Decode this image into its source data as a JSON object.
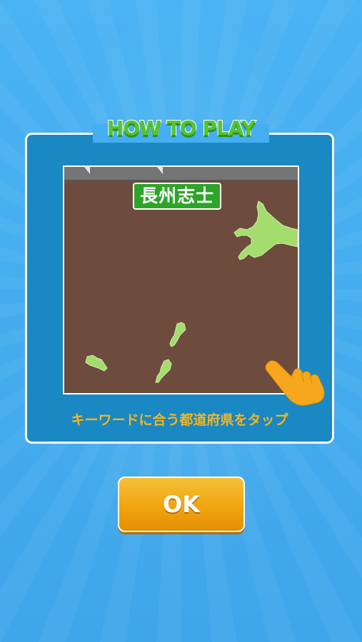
{
  "screen": {
    "title": "HOW TO PLAY",
    "keyword": "長州志士",
    "instruction": "キーワードに合う都道府県をタップ",
    "ok_button": "OK"
  },
  "demo_map": {
    "visible_regions": [
      "hokkaido-shape",
      "island-shape-a",
      "island-shape-b",
      "island-shape-c"
    ],
    "land_color": "#a4dc6e",
    "ground_color": "#6d4c3d"
  },
  "colors": {
    "background": "#45aef0",
    "panel": "#1a88c3",
    "title_green": "#55c433",
    "keyword_green": "#2ea42a",
    "instruction_orange": "#f7b51d",
    "button_orange": "#f0a50f"
  },
  "icons": {
    "tap_hint": "pointing-hand-icon"
  }
}
